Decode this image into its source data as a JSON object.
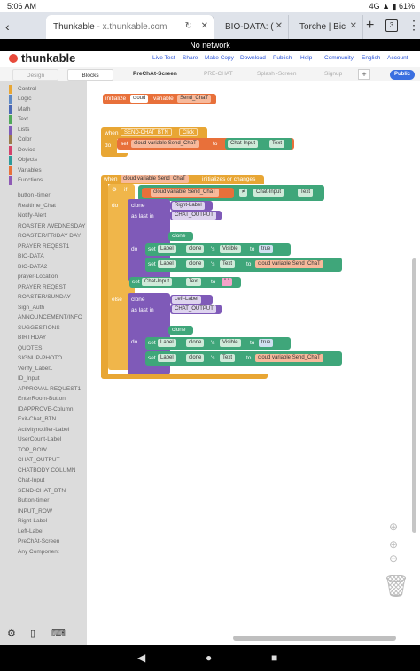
{
  "status": {
    "time": "5:06 AM",
    "right": "4G ▲ ▮ 61%"
  },
  "browser": {
    "tabs": [
      {
        "title": "Thunkable",
        "host": " - x.thunkable.com"
      },
      {
        "title": "BIO-DATA: ("
      },
      {
        "title": "Torche | Bic"
      }
    ],
    "tab_count": "3"
  },
  "banner": "No network",
  "thunkable": {
    "logo": "thunkable",
    "nav": [
      "Live Test",
      "Share",
      "Make Copy",
      "Download",
      "Publish",
      "Help",
      "Community",
      "English",
      "Account"
    ]
  },
  "screenrow": {
    "design": "Design",
    "blocks": "Blocks",
    "screens": [
      "PreChAt-Screen",
      "PRE-CHAT",
      "Splash -Screen",
      "Signup"
    ],
    "add": "+",
    "public": "Public"
  },
  "palette": {
    "categories": [
      {
        "label": "Control",
        "color": "#e8a634"
      },
      {
        "label": "Logic",
        "color": "#5e89c4"
      },
      {
        "label": "Math",
        "color": "#4a68b5"
      },
      {
        "label": "Text",
        "color": "#4fa859"
      },
      {
        "label": "Lists",
        "color": "#7f5ab8"
      },
      {
        "label": "Color",
        "color": "#9a7c4a"
      },
      {
        "label": "Device",
        "color": "#d3426b"
      },
      {
        "label": "Objects",
        "color": "#2d9a9a"
      },
      {
        "label": "Variables",
        "color": "#e8703a"
      },
      {
        "label": "Functions",
        "color": "#8e5ab5"
      }
    ],
    "components": [
      "button -timer",
      "Realtime_Chat",
      "Notify-Alert",
      "ROASTER /WEDNESDAY",
      "ROASTER/FRIDAY DAY",
      "PRAYER REQEST1",
      "BIO-DATA",
      "BIO-DATA2",
      "prayer-Location",
      "PRAYER REQEST",
      "ROASTER/SUNDAY",
      "Sign_Auth",
      "ANNOUNCEMENT/INFO",
      "SUGGESTIONS",
      "BIRTHDAY",
      "QUOTES",
      "SIGNUP-PHOTO",
      "Verify_Label1",
      "ID_Input",
      "APPROVAL REQUEST1",
      "EnterRoom-Button",
      "IDAPPROVE-Column",
      "Exit-Chat_BTN",
      "Activitynotifier-Label",
      "UserCount-Label",
      "TOP_ROW",
      "CHAT_OUTPUT",
      "CHATBODY COLUMN",
      "Chat-Input",
      "SEND-CHAT_BTN",
      "Button-timer",
      "INPUT_ROW",
      "Right-Label",
      "Left-Label",
      "PreChAt-Screen",
      "Any Component"
    ]
  },
  "blocks": {
    "init": {
      "initialize": "initialize",
      "cloud": "cloud",
      "variable": "variable",
      "name": "Send_ChaT"
    },
    "click": {
      "when": "when",
      "button": "SEND-CHAT_BTN",
      "event": "Click",
      "do": "do",
      "set": "set",
      "var": "cloud variable Send_ChaT",
      "to": "to",
      "source": "Chat-Input",
      "prop": "Text"
    },
    "change": {
      "when": "when",
      "var": "cloud variable Send_ChaT",
      "event": "initializes or changes",
      "do": "do",
      "if": "if",
      "cmp_var": "cloud variable Send_ChaT",
      "op": "≠",
      "cmp_comp": "Chat-Input",
      "cmp_prop": "Text",
      "do1": "do",
      "clone": "clone",
      "right_label": "Right-Label",
      "as_last_in": "as last in",
      "output": "CHAT_OUTPUT",
      "clone_var": "clone",
      "do2": "do",
      "set": "set",
      "label": "Label",
      "s": "'s",
      "visible": "Visible",
      "to": "to",
      "true": "true",
      "text": "Text",
      "cloud_var": "cloud variable Send_ChaT",
      "input": "Chat-Input",
      "empty": "\" \"",
      "else": "else",
      "left_label": "Left-Label"
    }
  }
}
